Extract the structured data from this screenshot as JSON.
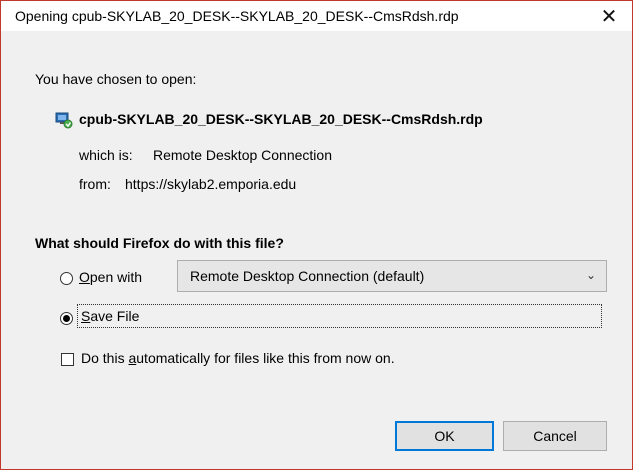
{
  "window": {
    "title": "Opening cpub-SKYLAB_20_DESK--SKYLAB_20_DESK--CmsRdsh.rdp",
    "close_glyph": "✕"
  },
  "dialog": {
    "intro": "You have chosen to open:",
    "file_icon": "remote-desktop-file-icon",
    "filename": "cpub-SKYLAB_20_DESK--SKYLAB_20_DESK--CmsRdsh.rdp",
    "which_label": "which is:",
    "which_value": "Remote Desktop Connection",
    "from_label": "from:",
    "from_value": "https://skylab2.emporia.edu",
    "question": "What should Firefox do with this file?",
    "open_with": {
      "label_accel": "O",
      "label_rest": "pen with",
      "selected": false,
      "app_selected": "Remote Desktop Connection (default)"
    },
    "save_file": {
      "label_accel": "S",
      "label_rest": "ave File",
      "selected": true
    },
    "auto": {
      "label_pre": "Do this ",
      "label_accel": "a",
      "label_post": "utomatically for files like this from now on.",
      "checked": false
    }
  },
  "buttons": {
    "ok": "OK",
    "cancel": "Cancel"
  },
  "colors": {
    "frame_border": "#c0392b",
    "dialog_bg": "#f0f0f0",
    "ok_focus": "#0078d7"
  }
}
